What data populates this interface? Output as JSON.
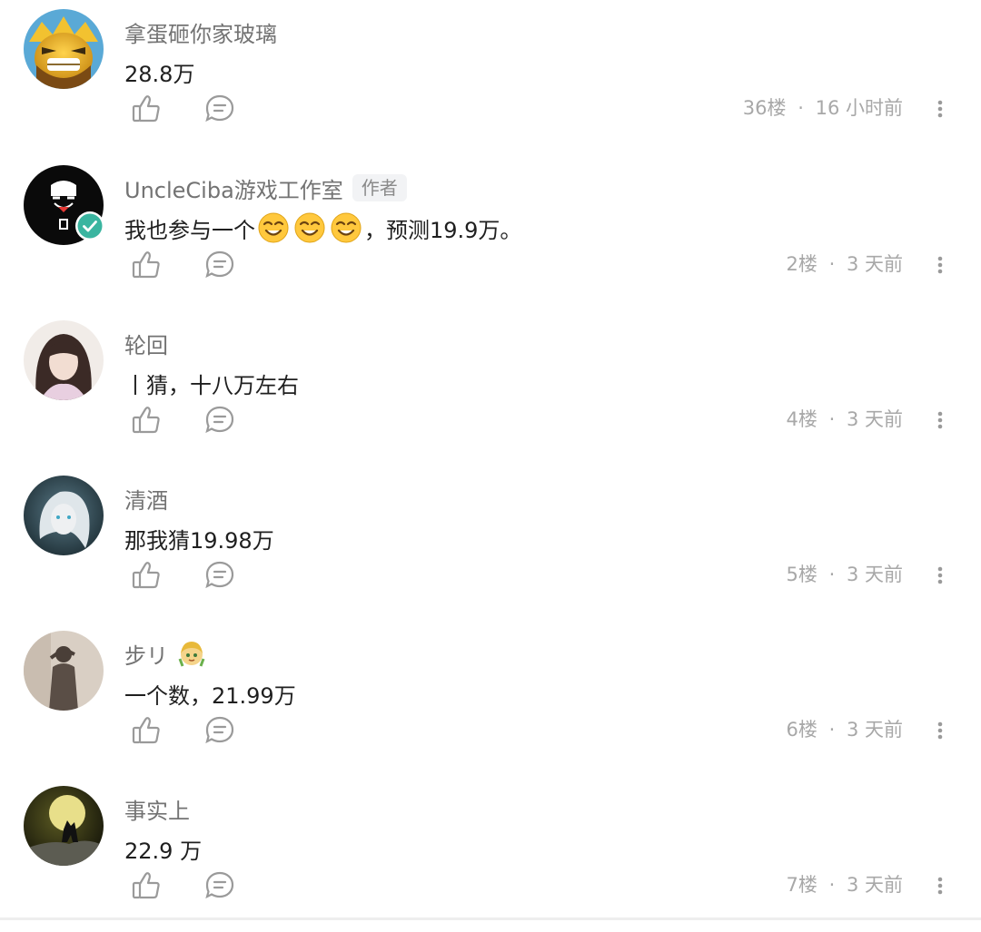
{
  "comments": [
    {
      "name": "拿蛋砸你家玻璃",
      "text": "28.8万",
      "floor": "36楼",
      "time": "16 小时前"
    },
    {
      "name": "UncleCiba游戏工作室",
      "badge": "作者",
      "text_before": "我也参与一个",
      "text_after": "，预测19.9万。",
      "floor": "2楼",
      "time": "3 天前"
    },
    {
      "name": "轮回",
      "text": "丨猜，十八万左右",
      "floor": "4楼",
      "time": "3 天前"
    },
    {
      "name": "清酒",
      "text": "那我猜19.98万",
      "floor": "5楼",
      "time": "3 天前"
    },
    {
      "name": "步リ",
      "text": "一个数，21.99万",
      "floor": "6楼",
      "time": "3 天前"
    },
    {
      "name": "事实上",
      "text": "22.9 万",
      "floor": "7楼",
      "time": "3 天前"
    }
  ],
  "meta_separator": "·",
  "icons": {
    "like": "thumbs-up-icon",
    "reply": "comment-bubble-icon",
    "more": "vertical-more-icon",
    "verified": "verified-check-icon",
    "emoji": "smiling-face-emoji-icon"
  },
  "colors": {
    "name": "#737373",
    "text": "#1f1f1f",
    "meta": "#a8a8a8",
    "icon": "#9a9a9a",
    "verified": "#3ab5a0",
    "badge_bg": "#f2f3f5"
  }
}
